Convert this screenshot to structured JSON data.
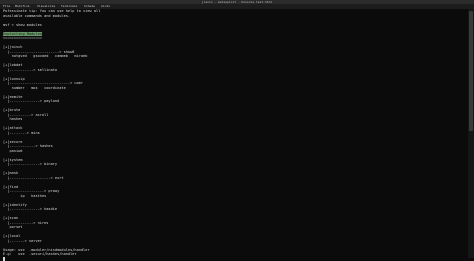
{
  "window": {
    "title": "jiaxio - metasploit - Konsole test.html"
  },
  "menu": [
    "File",
    "Modifica",
    "Visualizza",
    "Terminale",
    "Schede",
    "Aiuto"
  ],
  "terminal": {
    "lines": [
      "Pofessinate tip: You can use help to view all",
      "available commands and modules.",
      "",
      "msf > show modules",
      "",
      "Exploiting Modules",
      "==================",
      "",
      "[+]joisch",
      "  |-----------------------> show8",
      "    notgved   gsovaed   cammeb   miraeb",
      "",
      "[+]lobdat",
      "  |-----------> sellinato",
      "",
      "[+]lonnuip",
      "  |----------------------------> uaer",
      "    number   mos   coordinate",
      "",
      "[+]eemite",
      "  |--------------> paylond",
      "",
      "[+]brute",
      "  |----------> acroll",
      "   hashes",
      "",
      "[+]attack",
      "  |--------> mins",
      "",
      "[+]secure",
      "  |------------> hashes",
      "   pasiwd",
      "",
      "[+]system",
      "  |--------------> binary",
      "",
      "[+]mask",
      "  |-------------------> exrt",
      "",
      "[+]find",
      "  |----------------> prowy",
      "        ip   hasthes",
      "",
      "[+]identify",
      "  |--------------> hasdie",
      "",
      "[+]scan",
      "  |-----------> nires",
      "   porset",
      "",
      "[+]local",
      "  |-------> server",
      "",
      "Usage: use  .moduler/nisdmodules/handler",
      "E.g:   use  .securi/hashes/handler"
    ]
  }
}
